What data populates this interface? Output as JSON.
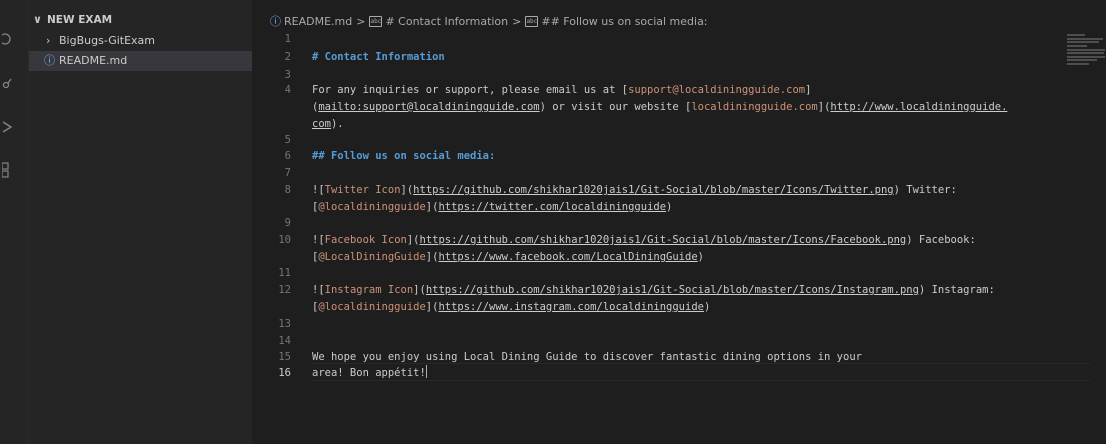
{
  "explorer": {
    "section_title": "NEW EXAM",
    "items": [
      {
        "label": "BigBugs-GitExam",
        "type": "folder"
      },
      {
        "label": "README.md",
        "type": "file",
        "status_icon": "ⓘ"
      }
    ]
  },
  "activity_bar": {
    "icons": [
      "search-icon",
      "source-control-icon",
      "run-debug-icon",
      "extensions-icon"
    ]
  },
  "breadcrumb": {
    "info_icon": "ⓘ",
    "file": "README.md",
    "sep": ">",
    "sym_icon": "abc",
    "crumb1": "# Contact Information",
    "crumb2": "## Follow us on social media:"
  },
  "editor": {
    "line_numbers": [
      "1",
      "2",
      "3",
      "4",
      "5",
      "6",
      "7",
      "8",
      "9",
      "10",
      "11",
      "12",
      "13",
      "14",
      "15",
      "16"
    ],
    "active_line": "16",
    "l2": "# Contact Information",
    "l4a": "For any inquiries or support, please email us at [",
    "l4b": "support@localdiningguide.com",
    "l4c": "]",
    "l4d": "(",
    "l4e": "mailto:support@localdiningguide.com",
    "l4f": ") or visit our website [",
    "l4g": "localdiningguide.com",
    "l4h": "](",
    "l4i": "http://www.localdiningguide.",
    "l4j": "com",
    "l4k": ").",
    "l6": "## Follow us on social media:",
    "l8a": "![",
    "l8b": "Twitter Icon",
    "l8c": "](",
    "l8d": "https://github.com/shikhar1020jais1/Git-Social/blob/master/Icons/Twitter.png",
    "l8e": ") Twitter:",
    "l8f": "[",
    "l8g": "@localdiningguide",
    "l8h": "](",
    "l8i": "https://twitter.com/localdiningguide",
    "l8j": ")",
    "l10a": "![",
    "l10b": "Facebook Icon",
    "l10c": "](",
    "l10d": "https://github.com/shikhar1020jais1/Git-Social/blob/master/Icons/Facebook.png",
    "l10e": ") Facebook:",
    "l10f": "[",
    "l10g": "@LocalDiningGuide",
    "l10h": "](",
    "l10i": "https://www.facebook.com/LocalDiningGuide",
    "l10j": ")",
    "l12a": "![",
    "l12b": "Instagram Icon",
    "l12c": "](",
    "l12d": "https://github.com/shikhar1020jais1/Git-Social/blob/master/Icons/Instagram.png",
    "l12e": ") Instagram:",
    "l12f": "[",
    "l12g": "@localdiningguide",
    "l12h": "](",
    "l12i": "https://www.instagram.com/localdiningguide",
    "l12j": ")",
    "l15": "We hope you enjoy using Local Dining Guide to discover fantastic dining options in your",
    "l16": "area! Bon appétit!"
  },
  "colors": {
    "heading": "#569cd6",
    "link_text": "#ce9178",
    "background": "#1e1e1e",
    "sidebar": "#252526"
  }
}
